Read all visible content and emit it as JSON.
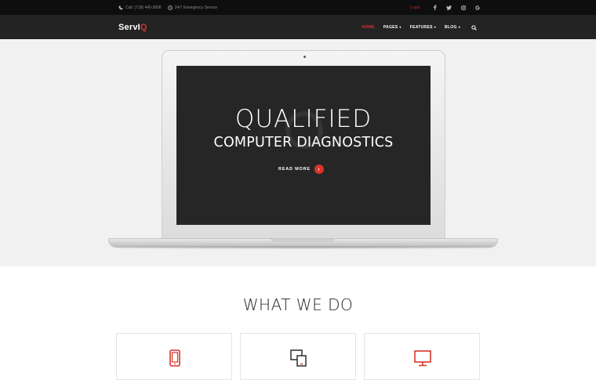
{
  "topbar": {
    "phone_icon": "phone-icon",
    "phone_text": "Call: (718) 445-3808",
    "clock_icon": "clock-icon",
    "service_text": "24/7 Emergency Service",
    "login_label": "Login",
    "social": [
      {
        "icon": "facebook-icon",
        "glyph": "f"
      },
      {
        "icon": "twitter-icon",
        "glyph": "t"
      },
      {
        "icon": "instagram-icon",
        "glyph": "◎"
      },
      {
        "icon": "google-icon",
        "glyph": "G"
      }
    ]
  },
  "navbar": {
    "logo_main": "ServI",
    "logo_accent": "Q",
    "items": [
      {
        "label": "HOME",
        "active": true
      },
      {
        "label": "PAGES",
        "caret": "▾"
      },
      {
        "label": "FEATURES",
        "caret": "▾"
      },
      {
        "label": "BLOG",
        "caret": "▾"
      }
    ],
    "search_icon": "search-icon"
  },
  "hero": {
    "headline": "QUALIFIED",
    "subline": "COMPUTER DIAGNOSTICS",
    "read_more": "READ MORE",
    "arrow": "›"
  },
  "services": {
    "title": "WHAT WE DO",
    "cards": [
      {
        "icon": "mobile-phone-icon"
      },
      {
        "icon": "devices-icon"
      },
      {
        "icon": "monitor-icon"
      }
    ]
  },
  "colors": {
    "accent": "#d9342b",
    "topbar_bg": "#0e0e0e",
    "navbar_bg": "#232323",
    "screen_bg": "#262626"
  }
}
